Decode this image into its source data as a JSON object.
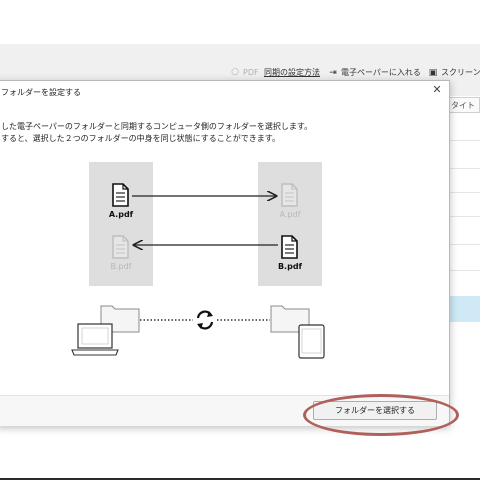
{
  "toolbar": {
    "pdf_label": "PDF",
    "sync_settings_link": "同期の設定方法",
    "import_label": "電子ペーパーに入れる",
    "screen_label": "スクリーン"
  },
  "list": {
    "column_header": "タイト"
  },
  "dialog": {
    "title": "フォルダーを設定する",
    "description_line1": "した電子ペーパーのフォルダーと同期するコンピュータ側のフォルダーを選択します。",
    "description_line2": "すると、選択した２つのフォルダーの中身を同じ状態にすることができます。",
    "select_button_label": "フォルダーを選択する"
  },
  "diagram": {
    "left_file_a": "A.pdf",
    "left_file_b": "B.pdf",
    "right_file_a": "A.pdf",
    "right_file_b": "B.pdf"
  },
  "colors": {
    "highlight": "#b0605a",
    "selected_row": "#cfe9f6",
    "panel": "#dedede"
  }
}
